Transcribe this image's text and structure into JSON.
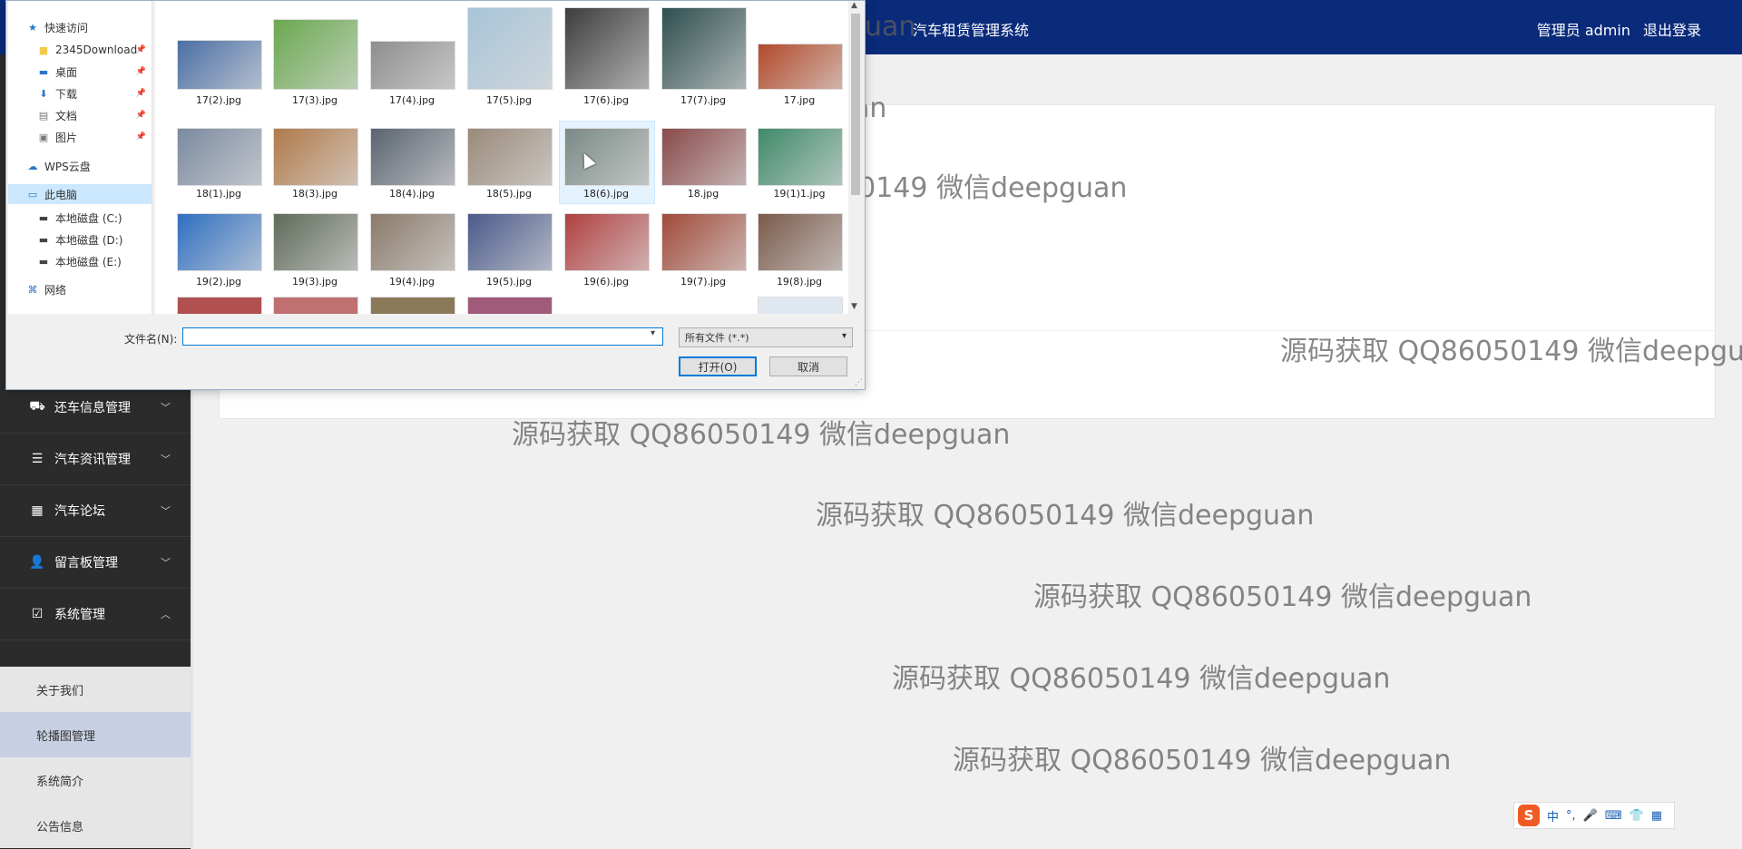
{
  "header": {
    "app_title": "汽车租赁管理系统",
    "user_label": "管理员 admin",
    "logout_label": "退出登录"
  },
  "sidebar": {
    "items": [
      {
        "label": "还车信息管理",
        "icon": "car-return-icon",
        "expanded": false
      },
      {
        "label": "汽车资讯管理",
        "icon": "list-icon",
        "expanded": false
      },
      {
        "label": "汽车论坛",
        "icon": "grid-icon",
        "expanded": false
      },
      {
        "label": "留言板管理",
        "icon": "user-icon",
        "expanded": false
      },
      {
        "label": "系统管理",
        "icon": "checklist-icon",
        "expanded": true
      }
    ],
    "sub_items": [
      {
        "label": "关于我们",
        "active": false
      },
      {
        "label": "轮播图管理",
        "active": true
      },
      {
        "label": "系统简介",
        "active": false
      },
      {
        "label": "公告信息",
        "active": false
      }
    ]
  },
  "watermark": {
    "text": "源码获取 QQ86050149 微信deepguan"
  },
  "dialog": {
    "nav": [
      {
        "label": "快速访问",
        "icon": "star-icon",
        "pinned": false
      },
      {
        "label": "2345Download",
        "icon": "folder-icon",
        "pinned": true
      },
      {
        "label": "桌面",
        "icon": "desktop-icon",
        "pinned": true
      },
      {
        "label": "下载",
        "icon": "download-icon",
        "pinned": true
      },
      {
        "label": "文档",
        "icon": "document-icon",
        "pinned": true
      },
      {
        "label": "图片",
        "icon": "picture-icon",
        "pinned": true
      },
      {
        "label": "WPS云盘",
        "icon": "cloud-icon",
        "pinned": false
      },
      {
        "label": "此电脑",
        "icon": "computer-icon",
        "pinned": false
      },
      {
        "label": "本地磁盘 (C:)",
        "icon": "drive-icon",
        "pinned": false
      },
      {
        "label": "本地磁盘 (D:)",
        "icon": "drive-icon",
        "pinned": false
      },
      {
        "label": "本地磁盘 (E:)",
        "icon": "drive-icon",
        "pinned": false
      },
      {
        "label": "网络",
        "icon": "network-icon",
        "pinned": false
      }
    ],
    "files": [
      {
        "name": "17(2).jpg",
        "color": "#4a6fa5"
      },
      {
        "name": "17(3).jpg",
        "color": "#6aa84f"
      },
      {
        "name": "17(4).jpg",
        "color": "#8e8e8e"
      },
      {
        "name": "17(5).jpg",
        "color": "#a7c4d8"
      },
      {
        "name": "17(6).jpg",
        "color": "#3d3d3d"
      },
      {
        "name": "17(7).jpg",
        "color": "#2f4f4f"
      },
      {
        "name": "17.jpg",
        "color": "#b24a2a"
      },
      {
        "name": "18(1).jpg",
        "color": "#7b8aa0"
      },
      {
        "name": "18(3).jpg",
        "color": "#b07a4a"
      },
      {
        "name": "18(4).jpg",
        "color": "#5a6470"
      },
      {
        "name": "18(5).jpg",
        "color": "#9a8a7a"
      },
      {
        "name": "18(6).jpg",
        "color": "#7a8a86"
      },
      {
        "name": "18.jpg",
        "color": "#8a4a4a"
      },
      {
        "name": "19(1)1.jpg",
        "color": "#3f8a6a"
      },
      {
        "name": "19(2).jpg",
        "color": "#2f6fc0"
      },
      {
        "name": "19(3).jpg",
        "color": "#5f6a5a"
      },
      {
        "name": "19(4).jpg",
        "color": "#8a7a6a"
      },
      {
        "name": "19(5).jpg",
        "color": "#4a5a8a"
      },
      {
        "name": "19(6).jpg",
        "color": "#b04040"
      },
      {
        "name": "19(7).jpg",
        "color": "#a04a3a"
      },
      {
        "name": "19(8).jpg",
        "color": "#7a5a4a"
      }
    ],
    "filename_label": "文件名(N):",
    "filename_value": "",
    "filter_label": "所有文件 (*.*)",
    "open_label": "打开(O)",
    "cancel_label": "取消"
  },
  "ime": {
    "logo": "S",
    "mode": "中",
    "punct": "°,"
  }
}
